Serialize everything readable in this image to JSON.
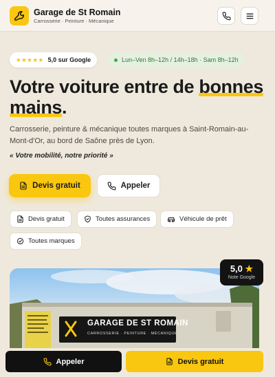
{
  "header": {
    "name": "Garage de St Romain",
    "tagline": "Carrosserie · Peinture · Mécanique",
    "phone_icon": "phone-icon",
    "menu_icon": "menu-icon"
  },
  "rating_pill": {
    "stars": "★★★★★",
    "text": "5,0 sur Google"
  },
  "hours_pill": {
    "text": "Lun–Ven 8h–12h / 14h–18h · Sam 8h–12h"
  },
  "hero": {
    "line_a": "Votre voiture entre de ",
    "highlight_a": "bonnes",
    "highlight_b": "mains",
    "end": "."
  },
  "subtitle": "Carrosserie, peinture & mécanique toutes marques à Saint-Romain-au-Mont-d'Or, au bord de Saône près de Lyon.",
  "motto": "« Votre mobilité, notre priorité »",
  "cta": {
    "quote": "Devis gratuit",
    "call": "Appeler"
  },
  "features": [
    {
      "label": "Devis gratuit",
      "icon": "document-icon"
    },
    {
      "label": "Toutes assurances",
      "icon": "shield-check-icon"
    },
    {
      "label": "Véhicule de prêt",
      "icon": "car-icon"
    },
    {
      "label": "Toutes marques",
      "icon": "check-circle-icon"
    }
  ],
  "photo": {
    "sign_title": "GARAGE DE ST ROMAIN",
    "sign_sub": "CARROSSERIE · PEINTURE · MÉCANIQUE"
  },
  "google_badge": {
    "value": "5,0",
    "star": "★",
    "caption": "Note Google"
  },
  "bottom_bar": {
    "call": "Appeler",
    "quote": "Devis gratuit"
  },
  "colors": {
    "accent": "#f9c70f",
    "background": "#efe9dd",
    "dark": "#111111",
    "open": "#2e7a34"
  }
}
